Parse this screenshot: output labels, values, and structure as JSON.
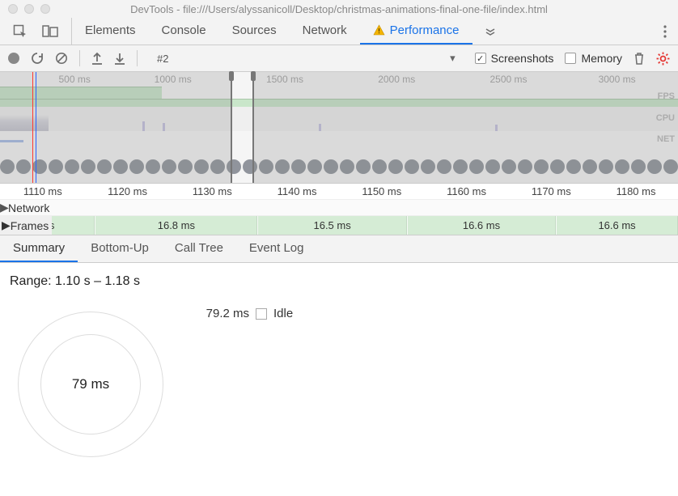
{
  "window": {
    "title": "DevTools - file:///Users/alyssanicoll/Desktop/christmas-animations-final-one-file/index.html"
  },
  "tabs": {
    "items": [
      "Elements",
      "Console",
      "Sources",
      "Network",
      "Performance"
    ],
    "active": 4,
    "warning_on": 4
  },
  "toolbar": {
    "profile": "#2",
    "screenshots_label": "Screenshots",
    "screenshots_checked": true,
    "memory_label": "Memory",
    "memory_checked": false
  },
  "overview": {
    "ticks": [
      {
        "label": "500 ms",
        "pct": 11.0
      },
      {
        "label": "1000 ms",
        "pct": 25.5
      },
      {
        "label": "1500 ms",
        "pct": 42.0
      },
      {
        "label": "2000 ms",
        "pct": 58.5
      },
      {
        "label": "2500 ms",
        "pct": 75.0
      },
      {
        "label": "3000 ms",
        "pct": 91.0
      }
    ],
    "labels": {
      "fps": "FPS",
      "cpu": "CPU",
      "net": "NET"
    },
    "selection": {
      "left_pct": 34.0,
      "right_pct": 37.5
    },
    "cursor_pct": 4.8
  },
  "timeline": {
    "ticks": [
      {
        "label": "1110 ms",
        "pct": 6.3
      },
      {
        "label": "1120 ms",
        "pct": 18.8
      },
      {
        "label": "1130 ms",
        "pct": 31.3
      },
      {
        "label": "1140 ms",
        "pct": 43.8
      },
      {
        "label": "1150 ms",
        "pct": 56.3
      },
      {
        "label": "1160 ms",
        "pct": 68.8
      },
      {
        "label": "1170 ms",
        "pct": 81.3
      },
      {
        "label": "1180 ms",
        "pct": 93.8
      }
    ],
    "network_label": "Network",
    "frames_label": "Frames",
    "frame_cells": [
      {
        "label": "ms",
        "left_pct": 0,
        "width_pct": 14
      },
      {
        "label": "16.8 ms",
        "left_pct": 14,
        "width_pct": 24
      },
      {
        "label": "16.5 ms",
        "left_pct": 38,
        "width_pct": 22
      },
      {
        "label": "16.6 ms",
        "left_pct": 60,
        "width_pct": 22
      },
      {
        "label": "16.6 ms",
        "left_pct": 82,
        "width_pct": 18
      }
    ]
  },
  "subtabs": {
    "items": [
      "Summary",
      "Bottom-Up",
      "Call Tree",
      "Event Log"
    ],
    "active": 0
  },
  "summary": {
    "range_label": "Range: 1.10 s – 1.18 s",
    "donut_center": "79 ms",
    "legend": [
      {
        "value": "79.2 ms",
        "name": "Idle"
      }
    ]
  }
}
